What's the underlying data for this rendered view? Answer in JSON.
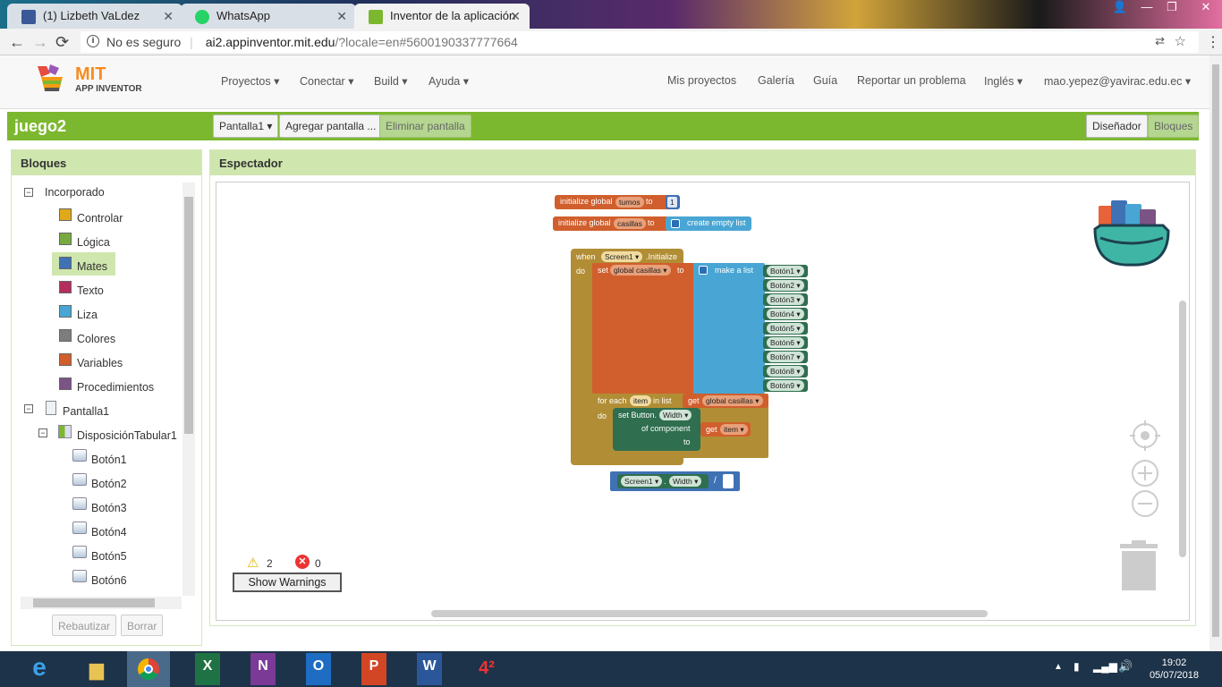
{
  "browser": {
    "tabs": [
      {
        "title": "(1) Lizbeth VaLdez",
        "icon": "facebook-icon",
        "color": "#3b5998"
      },
      {
        "title": "WhatsApp",
        "icon": "whatsapp-icon",
        "color": "#25d366"
      },
      {
        "title": "Inventor de la aplicación",
        "icon": "app-inventor-icon",
        "color": "#7cb82f"
      }
    ],
    "security_label": "No es seguro",
    "url_host": "ai2.appinventor.mit.edu",
    "url_rest": "/?locale=en#5600190337777664"
  },
  "header": {
    "logo_mit": "MIT",
    "logo_sub": "APP INVENTOR",
    "menus": [
      "Proyectos",
      "Conectar",
      "Build",
      "Ayuda"
    ],
    "right_links": [
      "Mis proyectos",
      "Galería",
      "Guía",
      "Reportar un problema"
    ],
    "language": "Inglés",
    "user": "mao.yepez@yavirac.edu.ec"
  },
  "toolbar": {
    "project": "juego2",
    "screen_select": "Pantalla1",
    "add_screen": "Agregar pantalla ...",
    "remove_screen": "Eliminar pantalla",
    "designer": "Diseñador",
    "blocks": "Bloques"
  },
  "blocks_panel": {
    "title": "Bloques",
    "builtin": "Incorporado",
    "categories": [
      {
        "label": "Controlar",
        "color": "#e1a91a"
      },
      {
        "label": "Lógica",
        "color": "#77ab41"
      },
      {
        "label": "Mates",
        "color": "#3f71b5"
      },
      {
        "label": "Texto",
        "color": "#b32d5e"
      },
      {
        "label": "Liza",
        "color": "#49a6d4"
      },
      {
        "label": "Colores",
        "color": "#7d7d7d"
      },
      {
        "label": "Variables",
        "color": "#d05f2d"
      },
      {
        "label": "Procedimientos",
        "color": "#7c5385"
      }
    ],
    "screen": "Pantalla1",
    "layout": "DisposiciónTabular1",
    "buttons": [
      "Botón1",
      "Botón2",
      "Botón3",
      "Botón4",
      "Botón5",
      "Botón6"
    ],
    "rename": "Rebautizar",
    "delete": "Borrar"
  },
  "viewer": {
    "title": "Espectador",
    "warnings": "2",
    "errors": "0",
    "show_warnings": "Show Warnings"
  },
  "code": {
    "init_global": "initialize global",
    "to": "to",
    "var_turnos": "turnos",
    "num_1": "1",
    "var_casillas": "casillas",
    "create_empty_list": "create empty list",
    "when": "when",
    "screen1": "Screen1",
    "initialize": ".Initialize",
    "do": "do",
    "set": "set",
    "global_casillas": "global casillas",
    "make_a_list": "make a list",
    "list_items": [
      "Botón1",
      "Botón2",
      "Botón3",
      "Botón4",
      "Botón5",
      "Botón6",
      "Botón7",
      "Botón8",
      "Botón9"
    ],
    "for_each": "for each",
    "item": "item",
    "in_list": "in list",
    "get": "get",
    "set_button": "set Button.",
    "width": "Width",
    "of_component": "of component",
    "dot": ".",
    "divide": "/"
  },
  "taskbar": {
    "time": "19:02",
    "date": "05/07/2018"
  }
}
